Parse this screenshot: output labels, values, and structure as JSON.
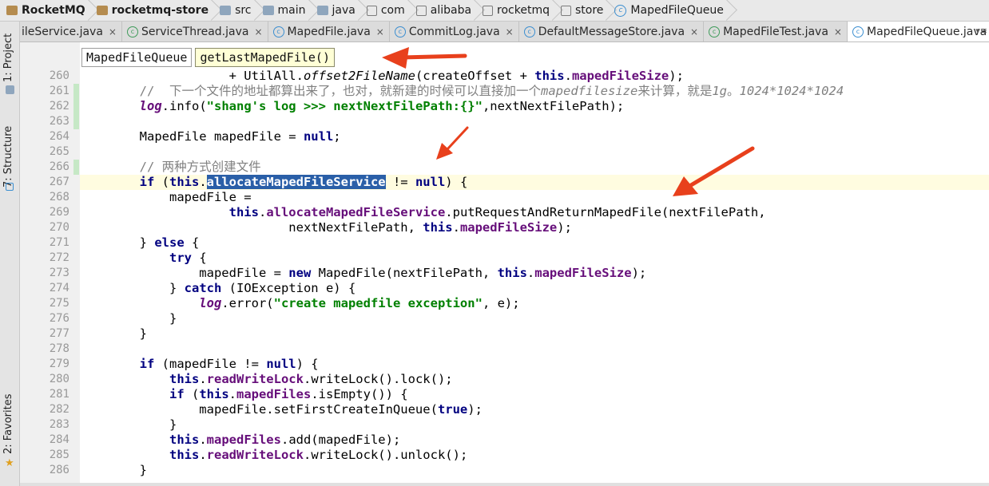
{
  "breadcrumb": [
    "RocketMQ",
    "rocketmq-store",
    "src",
    "main",
    "java",
    "com",
    "alibaba",
    "rocketmq",
    "store",
    "MapedFileQueue"
  ],
  "tabs": [
    {
      "label": "ileService.java",
      "close": "×"
    },
    {
      "label": "ServiceThread.java",
      "close": "×"
    },
    {
      "label": "MapedFile.java",
      "close": "×"
    },
    {
      "label": "CommitLog.java",
      "close": "×"
    },
    {
      "label": "DefaultMessageStore.java",
      "close": "×"
    },
    {
      "label": "MapedFileTest.java",
      "close": "×"
    },
    {
      "label": "MapedFileQueue.java",
      "close": "×"
    }
  ],
  "tab_overflow": "▾≡",
  "side_tabs": [
    "1: Project",
    "7: Structure",
    "2: Favorites"
  ],
  "nav_popup": {
    "class_name": "MapedFileQueue",
    "method_name": "getLastMapedFile()"
  },
  "line_numbers": [
    "260",
    "261",
    "262",
    "263",
    "264",
    "265",
    "266",
    "267",
    "268",
    "269",
    "270",
    "271",
    "272",
    "273",
    "274",
    "275",
    "276",
    "277",
    "278",
    "279",
    "280",
    "281",
    "282",
    "283",
    "284",
    "285",
    "286"
  ],
  "code": {
    "l260": [
      "                    + UtilAll.",
      "offset2FileName",
      "(createOffset + ",
      "this",
      ".",
      "mapedFileSize",
      ");"
    ],
    "l261": [
      "        //  ",
      "下一个文件的地址都算出来了，也对，就新建的时候可以直接加一个",
      "mapedfilesize",
      "来计算，就是",
      "1g",
      "。",
      "1024*1024*1024"
    ],
    "l262": [
      "        ",
      "log",
      ".info(",
      "\"shang's log >>> nextNextFilePath:{}\"",
      ",nextNextFilePath);"
    ],
    "l264": [
      "        MapedFile mapedFile = ",
      "null",
      ";"
    ],
    "l266": [
      "        // ",
      "两种方式创建文件"
    ],
    "l267": [
      "        ",
      "if",
      " (",
      "this",
      ".",
      "allocateMapedFileService",
      " != ",
      "null",
      ") {"
    ],
    "l268": [
      "            mapedFile ="
    ],
    "l269": [
      "                    ",
      "this",
      ".",
      "allocateMapedFileService",
      ".putRequestAndReturnMapedFile(nextFilePath,"
    ],
    "l270": [
      "                            nextNextFilePath, ",
      "this",
      ".",
      "mapedFileSize",
      ");"
    ],
    "l271": [
      "        } ",
      "else",
      " {"
    ],
    "l272": [
      "            ",
      "try",
      " {"
    ],
    "l273": [
      "                mapedFile = ",
      "new",
      " MapedFile(nextFilePath, ",
      "this",
      ".",
      "mapedFileSize",
      ");"
    ],
    "l274": [
      "            } ",
      "catch",
      " (IOException e) {"
    ],
    "l275": [
      "                ",
      "log",
      ".error(",
      "\"create mapedfile exception\"",
      ", e);"
    ],
    "l276": [
      "            }"
    ],
    "l277": [
      "        }"
    ],
    "l279": [
      "        ",
      "if",
      " (mapedFile != ",
      "null",
      ") {"
    ],
    "l280": [
      "            ",
      "this",
      ".",
      "readWriteLock",
      ".writeLock().lock();"
    ],
    "l281": [
      "            ",
      "if",
      " (",
      "this",
      ".",
      "mapedFiles",
      ".isEmpty()) {"
    ],
    "l282": [
      "                mapedFile.setFirstCreateInQueue(",
      "true",
      ");"
    ],
    "l283": [
      "            }"
    ],
    "l284": [
      "            ",
      "this",
      ".",
      "mapedFiles",
      ".add(mapedFile);"
    ],
    "l285": [
      "            ",
      "this",
      ".",
      "readWriteLock",
      ".writeLock().unlock();"
    ],
    "l286": [
      "        }"
    ]
  },
  "colors": {
    "keyword": "#000080",
    "field": "#660e7a",
    "string": "#008000",
    "comment": "#808080",
    "arrow": "#e8401c",
    "selection": "#2a5fa8"
  }
}
